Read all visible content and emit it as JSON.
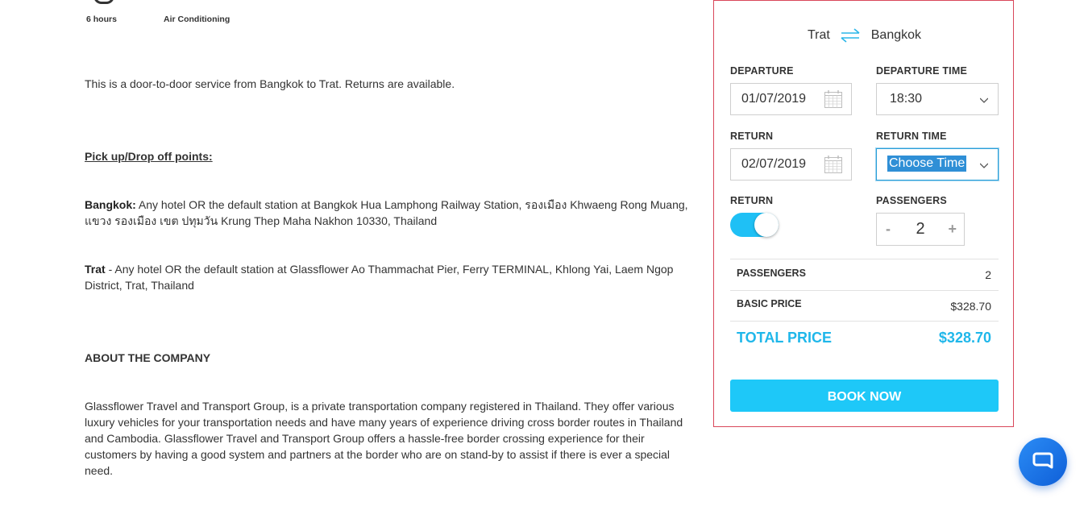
{
  "features": {
    "duration": "6 hours",
    "amenity": "Air Conditioning"
  },
  "description": {
    "intro": "This is a door-to-door service from Bangkok to Trat. Returns are available.",
    "points_heading": "Pick up/Drop off points:",
    "bangkok_label": "Bangkok:",
    "bangkok_text": " Any hotel OR the default station at Bangkok Hua Lamphong Railway Station, รองเมือง Khwaeng Rong Muang, แขวง รองเมือง เขต ปทุมวัน Krung Thep Maha Nakhon 10330, Thailand",
    "trat_label": "Trat",
    "trat_text": " - Any hotel OR the default station at Glassflower Ao Thammachat Pier, Ferry TERMINAL, Khlong Yai, Laem Ngop District, Trat, Thailand",
    "about_heading": "ABOUT THE COMPANY",
    "about_text": "Glassflower Travel and Transport Group, is a private transportation company registered in Thailand. They offer various luxury vehicles for your transportation needs and have many years of experience driving cross border routes in Thailand and Cambodia. Glassflower Travel and Transport Group offers a hassle-free border crossing experience for their customers by having a good system and partners at the border who are on stand-by to assist if there is ever a special need."
  },
  "booking": {
    "from": "Trat",
    "to": "Bangkok",
    "departure_label": "DEPARTURE",
    "departure_date": "01/07/2019",
    "departure_time_label": "DEPARTURE TIME",
    "departure_time": "18:30",
    "return_label": "RETURN",
    "return_date": "02/07/2019",
    "return_time_label": "RETURN TIME",
    "return_time": "Choose Time",
    "return_toggle_label": "RETURN",
    "return_toggle_on": true,
    "passengers_label": "PASSENGERS",
    "minus": "-",
    "passenger_count": "2",
    "plus": "+",
    "summary": {
      "passengers_label": "PASSENGERS",
      "passengers_value": "2",
      "basic_label": "BASIC PRICE",
      "basic_value": "$328.70",
      "total_label": "TOTAL PRICE",
      "total_value": "$328.70"
    },
    "book_label": "BOOK NOW"
  },
  "colors": {
    "accent": "#1ec8f8",
    "card_border": "#d9475a",
    "chat": "#1f74e8"
  },
  "icons": [
    "clock-icon",
    "ac-icon",
    "swap-arrows-icon",
    "calendar-icon",
    "chevron-down-icon",
    "chat-icon"
  ]
}
